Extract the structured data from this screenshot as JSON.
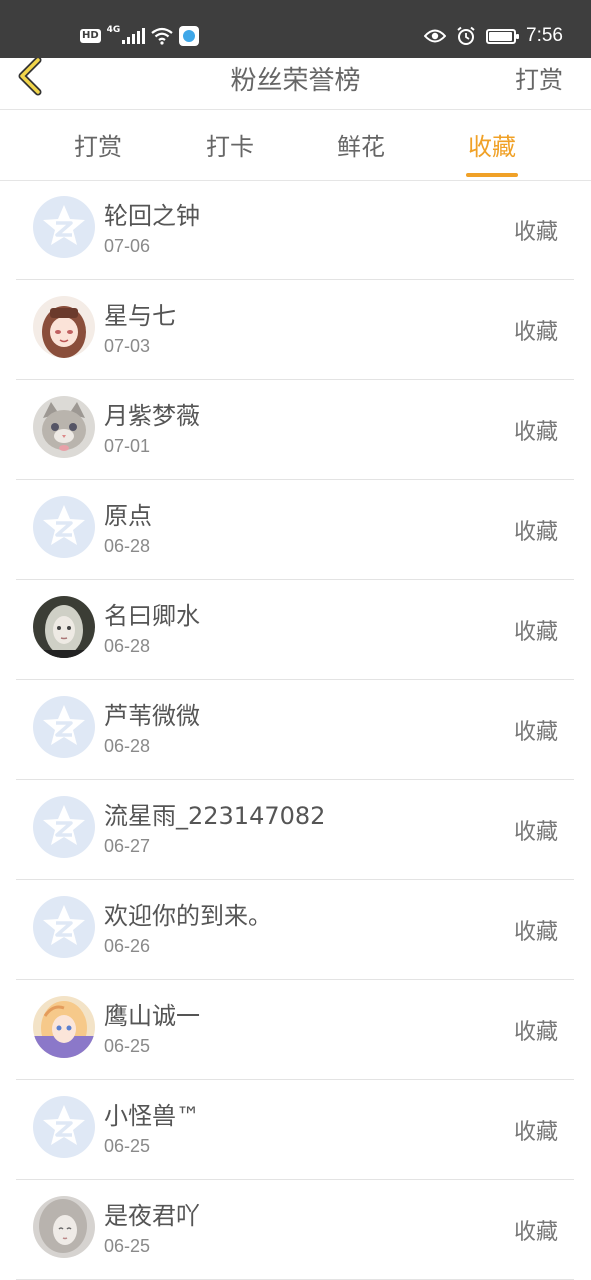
{
  "status_bar": {
    "hd": "HD",
    "network": "4G",
    "time": "7:56",
    "battery_level": 0.95
  },
  "header": {
    "title": "粉丝荣誉榜",
    "right_action": "打赏"
  },
  "tabs": [
    {
      "label": "打赏",
      "active": false
    },
    {
      "label": "打卡",
      "active": false
    },
    {
      "label": "鲜花",
      "active": false
    },
    {
      "label": "收藏",
      "active": true
    }
  ],
  "colors": {
    "accent": "#f0a127",
    "status_bar": "#3e3e3e",
    "default_avatar": "#dfe8f5"
  },
  "items": [
    {
      "name": "轮回之钟",
      "date": "07-06",
      "action": "收藏",
      "avatar": "default-avatar"
    },
    {
      "name": "星与七",
      "date": "07-03",
      "action": "收藏",
      "avatar": "anime-girl-avatar"
    },
    {
      "name": "月紫梦薇",
      "date": "07-01",
      "action": "收藏",
      "avatar": "cat-avatar"
    },
    {
      "name": "原点",
      "date": "06-28",
      "action": "收藏",
      "avatar": "default-avatar"
    },
    {
      "name": "名曰卿水",
      "date": "06-28",
      "action": "收藏",
      "avatar": "dark-portrait-avatar"
    },
    {
      "name": "芦苇微微",
      "date": "06-28",
      "action": "收藏",
      "avatar": "default-avatar"
    },
    {
      "name": "流星雨_223147082",
      "date": "06-27",
      "action": "收藏",
      "avatar": "default-avatar"
    },
    {
      "name": "欢迎你的到来。",
      "date": "06-26",
      "action": "收藏",
      "avatar": "default-avatar"
    },
    {
      "name": "鹰山诚一",
      "date": "06-25",
      "action": "收藏",
      "avatar": "colorful-anime-avatar"
    },
    {
      "name": "小怪兽™",
      "date": "06-25",
      "action": "收藏",
      "avatar": "default-avatar"
    },
    {
      "name": "是夜君吖",
      "date": "06-25",
      "action": "收藏",
      "avatar": "grey-portrait-avatar"
    }
  ]
}
